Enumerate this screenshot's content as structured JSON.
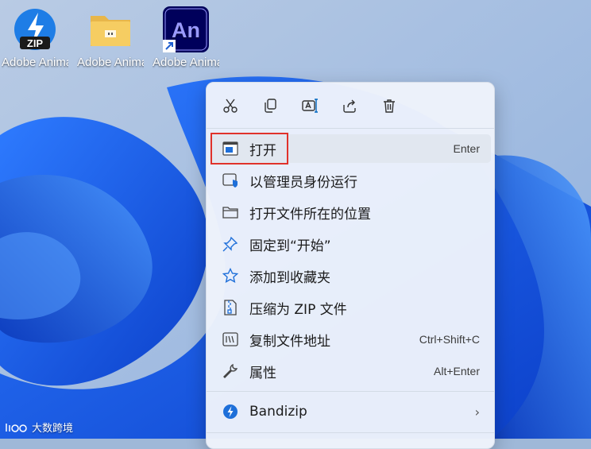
{
  "desktop": {
    "icons": [
      {
        "label": "Adobe Anima...",
        "icon": "zip-file-icon",
        "badge": "ZIP"
      },
      {
        "label": "Adobe Anima...",
        "icon": "folder-icon"
      },
      {
        "label": "Adobe Anima...",
        "icon": "adobe-animate-icon",
        "badge": "An"
      }
    ]
  },
  "context_menu": {
    "toolbar": [
      "cut-icon",
      "copy-icon",
      "rename-icon",
      "share-icon",
      "delete-icon"
    ],
    "items": [
      {
        "label": "打开",
        "shortcut": "Enter",
        "icon": "open-app-icon",
        "active": true
      },
      {
        "label": "以管理员身份运行",
        "shortcut": "",
        "icon": "shield-admin-icon"
      },
      {
        "label": "打开文件所在的位置",
        "shortcut": "",
        "icon": "folder-outline-icon"
      },
      {
        "label": "固定到“开始”",
        "shortcut": "",
        "icon": "pin-icon"
      },
      {
        "label": "添加到收藏夹",
        "shortcut": "",
        "icon": "star-icon"
      },
      {
        "label": "压缩为 ZIP 文件",
        "shortcut": "",
        "icon": "zip-compress-icon"
      },
      {
        "label": "复制文件地址",
        "shortcut": "Ctrl+Shift+C",
        "icon": "copy-path-icon"
      },
      {
        "label": "属性",
        "shortcut": "Alt+Enter",
        "icon": "wrench-icon"
      },
      {
        "label": "Bandizip",
        "submenu": true,
        "icon": "bandizip-icon"
      }
    ]
  },
  "watermark": {
    "text": "大数跨境"
  },
  "colors": {
    "accent": "#0067c0",
    "highlight_border": "#e0322b",
    "wallpaper_blue": "#1a5fe0"
  }
}
